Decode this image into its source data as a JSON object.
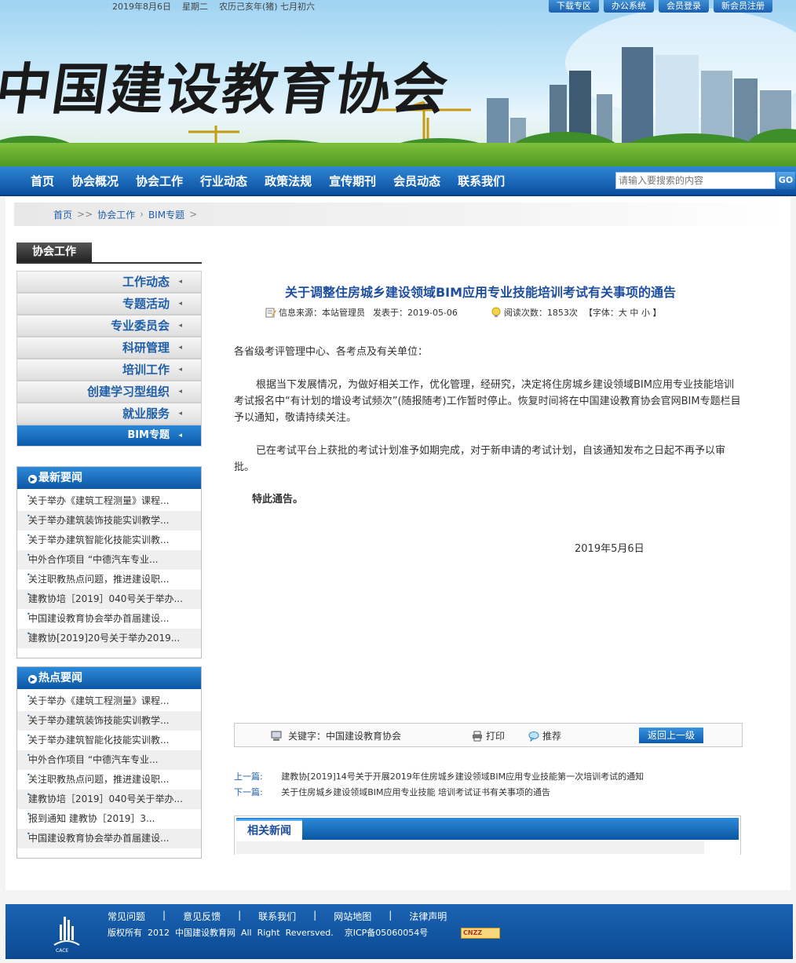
{
  "header": {
    "date_line": "2019年8月6日    星期二    农历己亥年(猪) 七月初六",
    "top_links": [
      "下载专区",
      "办公系统",
      "会员登录",
      "新会员注册"
    ],
    "site_name": "中国建设教育协会"
  },
  "nav": {
    "items": [
      "首页",
      "协会概况",
      "协会工作",
      "行业动态",
      "政策法规",
      "宣传期刊",
      "会员动态",
      "联系我们"
    ],
    "search_placeholder": "请输入要搜索的内容",
    "search_button": "GO"
  },
  "breadcrumb": {
    "items": [
      "首页",
      "协会工作",
      "BIM专题"
    ],
    "sep": ">>",
    "tail": ">"
  },
  "sidebar": {
    "title": "协会工作",
    "menu": [
      "工作动态",
      "专题活动",
      "专业委员会",
      "科研管理",
      "培训工作",
      "创建学习型组织",
      "就业服务",
      "BIM专题"
    ],
    "active_index": 7,
    "latest": {
      "title": "最新要闻",
      "items": [
        "关于举办《建筑工程测量》课程...",
        "关于举办建筑装饰技能实训教学...",
        "关于举办建筑智能化技能实训教...",
        "中外合作项目 “中德汽车专业...",
        "关注职教热点问题，推进建设职...",
        "建教协培［2019］040号关于举办...",
        "中国建设教育协会举办首届建设...",
        "建教协[2019]20号关于举办2019..."
      ]
    },
    "hot": {
      "title": "热点要闻",
      "items": [
        "关于举办《建筑工程测量》课程...",
        "关于举办建筑装饰技能实训教学...",
        "关于举办建筑智能化技能实训教...",
        "中外合作项目 “中德汽车专业...",
        "关注职教热点问题，推进建设职...",
        "建教协培［2019］040号关于举办...",
        "报到通知 建教协［2019］3...",
        "中国建设教育协会举办首届建设..."
      ]
    }
  },
  "article": {
    "title": "关于调整住房城乡建设领域BIM应用专业技能培训考试有关事项的通告",
    "meta_source": "信息来源：本站管理员",
    "meta_date": "发表于：2019-05-06",
    "meta_views": "阅读次数：1853次",
    "meta_font": "【字体：大 中 小 】",
    "salutation": "各省级考评管理中心、各考点及有关单位：",
    "para1": "根据当下发展情况，为做好相关工作，优化管理，经研究，决定将住房城乡建设领域BIM应用专业技能培训考试报名中“有计划的增设考试频次”(随报随考)工作暂时停止。恢复时间将在中国建设教育协会官网BIM专题栏目予以通知，敬请持续关注。",
    "para2": "已在考试平台上获批的考试计划准予如期完成，对于新申请的考试计划，自该通知发布之日起不再予以审批。",
    "closing": "特此通告。",
    "sign_date": "2019年5月6日"
  },
  "toolbar": {
    "keywords": "关键字：中国建设教育协会",
    "print": "打印",
    "recommend": "推荐",
    "back": "返回上一级"
  },
  "prevnext": {
    "prev_label": "上一篇:",
    "prev_title": "建教协[2019]14号关于开展2019年住房城乡建设领域BIM应用专业技能第一次培训考试的通知",
    "next_label": "下一篇:",
    "next_title": "关于住房城乡建设领域BIM应用专业技能 培训考试证书有关事项的通告"
  },
  "related": {
    "title": "相关新闻"
  },
  "footer": {
    "links": [
      "常见问题",
      "意见反馈",
      "联系我们",
      "网站地图",
      "法律声明"
    ],
    "link_sep": "|",
    "copyright": "版权所有  2012  中国建设教育网  All  Right  Reversved.    京ICP备05060054号",
    "cnzz": "CNZZ"
  },
  "colors": {
    "nav_blue": "#0b4fa0",
    "link_blue": "#1f5fa8",
    "title_blue": "#1d4e9e"
  }
}
